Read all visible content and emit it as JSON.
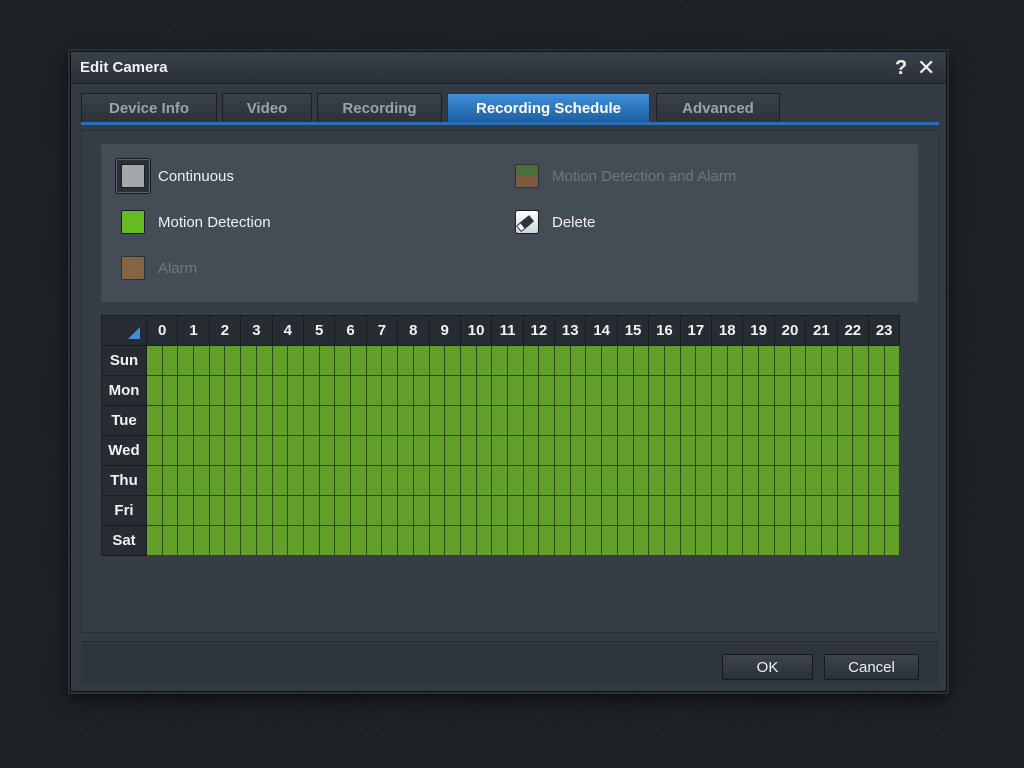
{
  "window": {
    "title": "Edit Camera",
    "help_glyph": "?",
    "close_glyph": "✕"
  },
  "tabs": [
    {
      "label": "Device Info",
      "active": false
    },
    {
      "label": "Video",
      "active": false
    },
    {
      "label": "Recording",
      "active": false
    },
    {
      "label": "Recording Schedule",
      "active": true
    },
    {
      "label": "Advanced",
      "active": false
    }
  ],
  "legend": {
    "continuous": {
      "label": "Continuous",
      "color": "#a3a8ad",
      "selected": true
    },
    "motion_detection": {
      "label": "Motion Detection",
      "color": "#66bb22"
    },
    "alarm": {
      "label": "Alarm",
      "color": "#b87a34",
      "disabled": true
    },
    "motion_alarm": {
      "label": "Motion Detection and Alarm",
      "color_top": "#4f8a2a",
      "color_bottom": "#a86a30",
      "disabled": true
    },
    "delete": {
      "label": "Delete",
      "icon": "eraser-icon"
    }
  },
  "schedule": {
    "days": [
      "Sun",
      "Mon",
      "Tue",
      "Wed",
      "Thu",
      "Fri",
      "Sat"
    ],
    "hours": [
      "0",
      "1",
      "2",
      "3",
      "4",
      "5",
      "6",
      "7",
      "8",
      "9",
      "10",
      "11",
      "12",
      "13",
      "14",
      "15",
      "16",
      "17",
      "18",
      "19",
      "20",
      "21",
      "22",
      "23"
    ],
    "cell_mode": "Motion Detection",
    "cell_color": "#62a02a"
  },
  "footer": {
    "ok_label": "OK",
    "cancel_label": "Cancel"
  }
}
